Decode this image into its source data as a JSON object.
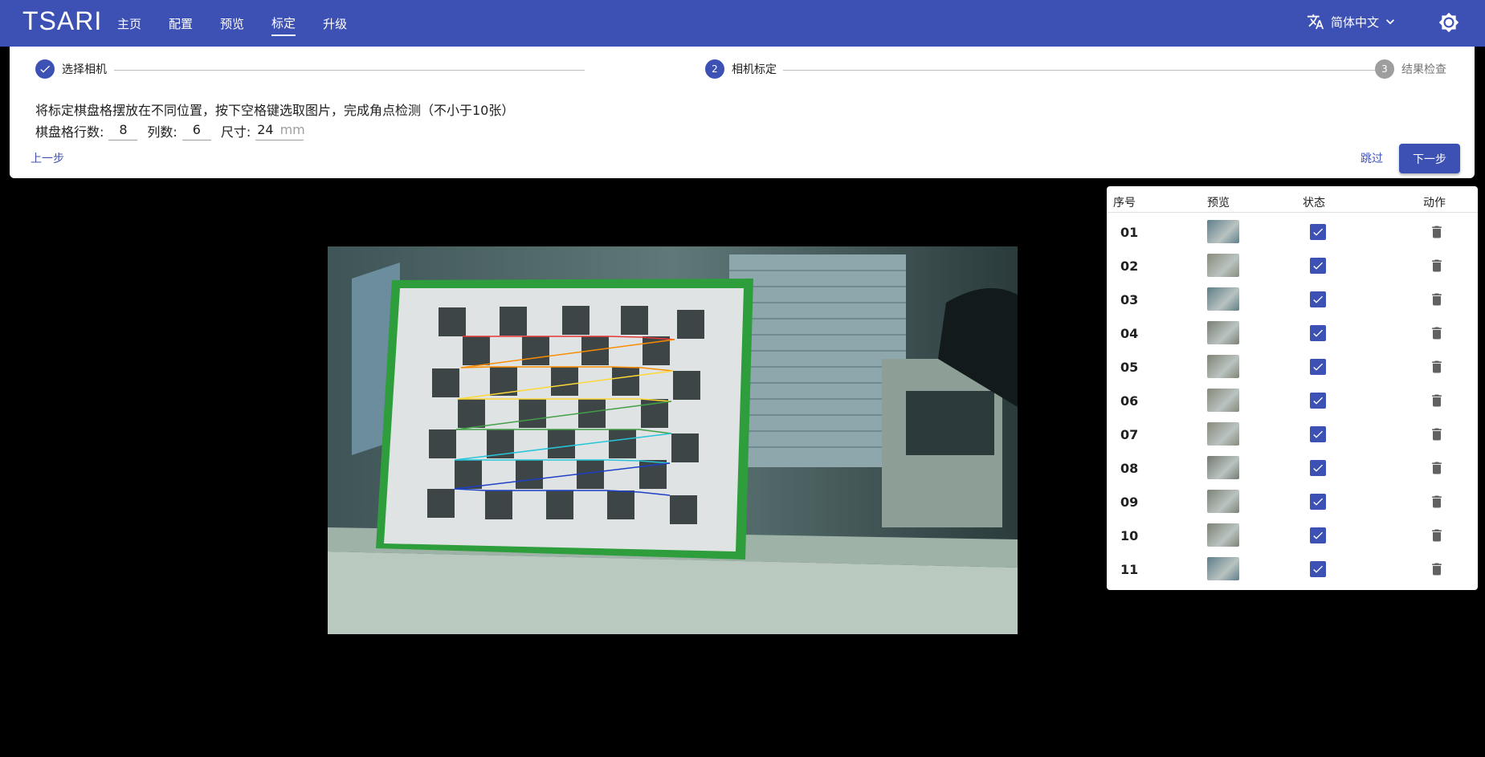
{
  "app": {
    "logo": "TSARI"
  },
  "nav": {
    "items": [
      "主页",
      "配置",
      "预览",
      "标定",
      "升级"
    ],
    "active": "标定"
  },
  "header": {
    "language": "简体中文"
  },
  "stepper": {
    "steps": [
      {
        "label": "选择相机",
        "state": "done"
      },
      {
        "label": "相机标定",
        "number": "2",
        "state": "active"
      },
      {
        "label": "结果检查",
        "number": "3",
        "state": "pending"
      }
    ],
    "instruction": "将标定棋盘格摆放在不同位置，按下空格键选取图片，完成角点检测（不小于10张）",
    "rows_label": "棋盘格行数:",
    "rows_value": "8",
    "cols_label": "列数:",
    "cols_value": "6",
    "size_label": "尺寸:",
    "size_value": "24",
    "size_unit": "mm",
    "prev_label": "上一步",
    "skip_label": "跳过",
    "next_label": "下一步"
  },
  "table": {
    "headers": {
      "index": "序号",
      "preview": "预览",
      "status": "状态",
      "action": "动作"
    },
    "rows": [
      {
        "index": "01",
        "thumb_color": "#5f7f8c",
        "checked": true
      },
      {
        "index": "02",
        "thumb_color": "#8a8c7c",
        "checked": true
      },
      {
        "index": "03",
        "thumb_color": "#5d7d88",
        "checked": true
      },
      {
        "index": "04",
        "thumb_color": "#7b7f74",
        "checked": true
      },
      {
        "index": "05",
        "thumb_color": "#818475",
        "checked": true
      },
      {
        "index": "06",
        "thumb_color": "#86887a",
        "checked": true
      },
      {
        "index": "07",
        "thumb_color": "#888a7d",
        "checked": true
      },
      {
        "index": "08",
        "thumb_color": "#757a72",
        "checked": true
      },
      {
        "index": "09",
        "thumb_color": "#7d8276",
        "checked": true
      },
      {
        "index": "10",
        "thumb_color": "#7e8276",
        "checked": true
      },
      {
        "index": "11",
        "thumb_color": "#5e7e8b",
        "checked": true
      }
    ]
  },
  "colors": {
    "primary": "#3d51b5",
    "background": "#000000"
  }
}
